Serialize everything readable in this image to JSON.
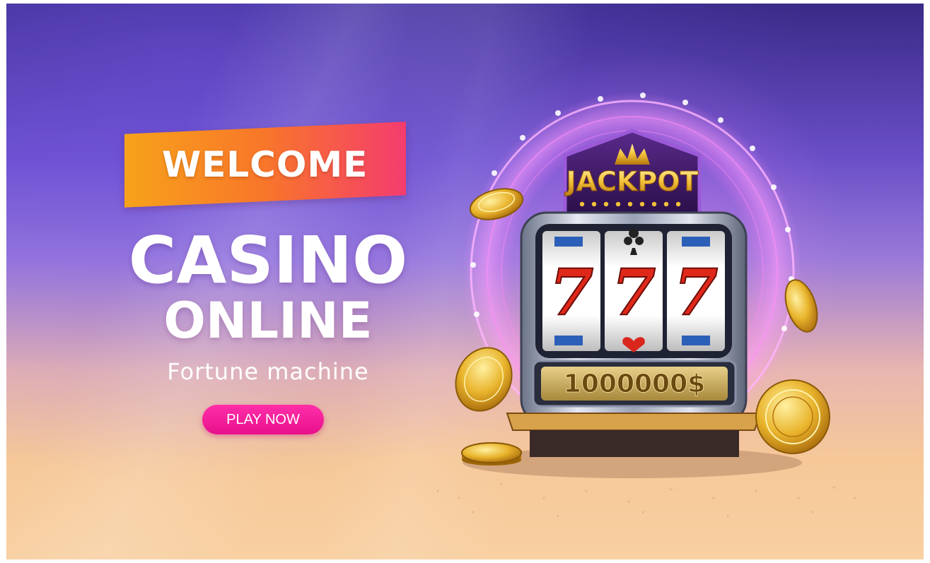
{
  "banner": {
    "welcome_label": "WELCOME",
    "headline_casino": "CASINO",
    "headline_online": "ONLINE",
    "tagline": "Fortune machine",
    "play_button_label": "PLAY NOW"
  },
  "slot_machine": {
    "sign_label": "JACKPOT",
    "reels": [
      "7",
      "7",
      "7"
    ],
    "prize_label": "1000000$"
  },
  "colors": {
    "ribbon_start": "#f7a21a",
    "ribbon_end": "#f43c6e",
    "play_button": "#ff2fa8",
    "gold": "#f2c23a",
    "seven_red": "#e0281a"
  }
}
